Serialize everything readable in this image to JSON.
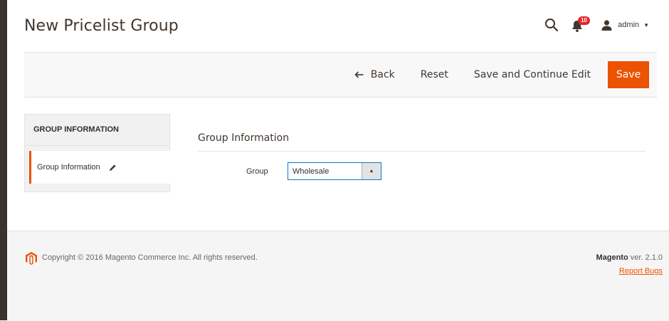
{
  "header": {
    "title": "New Pricelist Group",
    "notifications_count": "10",
    "user_name": "admin"
  },
  "action_bar": {
    "back_label": "Back",
    "reset_label": "Reset",
    "save_continue_label": "Save and Continue Edit",
    "save_label": "Save"
  },
  "sidebar": {
    "heading": "GROUP INFORMATION",
    "items": [
      {
        "label": "Group Information"
      }
    ]
  },
  "form": {
    "section_title": "Group Information",
    "group_label": "Group",
    "group_value": "Wholesale"
  },
  "footer": {
    "copyright": "Copyright © 2016 Magento Commerce Inc. All rights reserved.",
    "brand": "Magento",
    "version": " ver. 2.1.0",
    "report_bugs": "Report Bugs"
  },
  "colors": {
    "accent": "#eb5202",
    "badge": "#e22626",
    "focus": "#007bdb"
  },
  "icons": [
    "search-icon",
    "bell-icon",
    "user-icon",
    "caret-down-icon",
    "arrow-left-icon",
    "pencil-icon",
    "caret-up-icon",
    "magento-logo-icon"
  ]
}
